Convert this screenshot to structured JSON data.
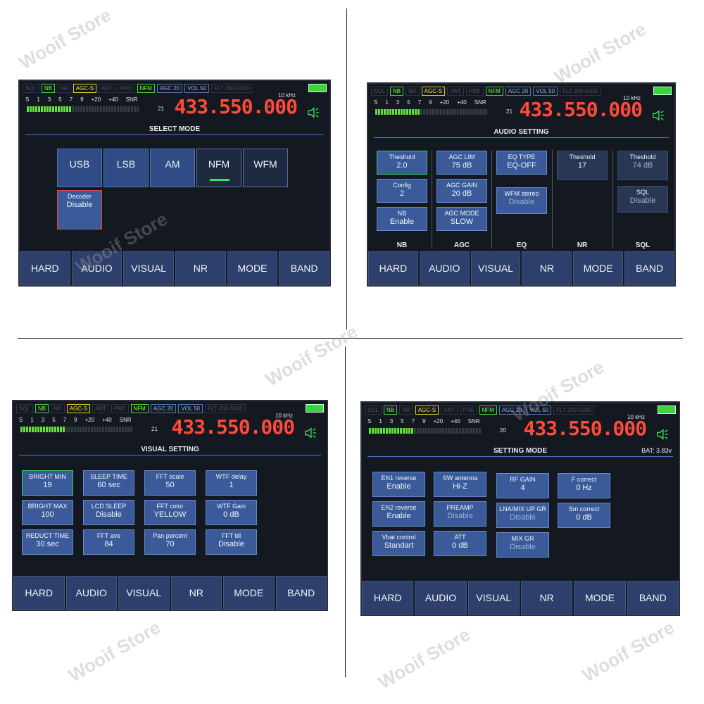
{
  "watermark": "Wooif Store",
  "status": {
    "items": [
      "SQL",
      "NB",
      "NR",
      "AGC-S",
      "ANT",
      "PRE",
      "NFM",
      "AGC 20",
      "VOL 50",
      "FLT 200-5000"
    ]
  },
  "meter": {
    "scale": [
      "S",
      "1",
      "3",
      "5",
      "7",
      "9",
      "+20",
      "+40",
      "SNR"
    ],
    "snr_value": "21",
    "snr_value_alt": "20",
    "step": "10 kHz",
    "frequency": "433.550.000"
  },
  "nav": [
    "HARD",
    "AUDIO",
    "VISUAL",
    "NR",
    "MODE",
    "BAND"
  ],
  "panel1": {
    "title": "SELECT MODE",
    "modes": [
      "USB",
      "LSB",
      "AM",
      "NFM",
      "WFM"
    ],
    "decoder_label": "Decoder",
    "decoder_value": "Disable"
  },
  "panel2": {
    "title": "AUDIO SETTING",
    "buttons": [
      {
        "label": "Theshold",
        "value": "2.0"
      },
      {
        "label": "Config",
        "value": "2"
      },
      {
        "label": "NB",
        "value": "Enable"
      },
      {
        "label": "AGC LIM",
        "value": "75 dB"
      },
      {
        "label": "AGC GAIN",
        "value": "20 dB"
      },
      {
        "label": "AGC MODE",
        "value": "SLOW"
      },
      {
        "label": "EQ TYPE",
        "value": "EQ-OFF"
      },
      {
        "label": "WFM stereo",
        "value": "Disable"
      },
      {
        "label": "Theshold",
        "value": "17"
      },
      {
        "label": "Theshold",
        "value": "74 dB"
      },
      {
        "label": "SQL",
        "value": "Disable"
      }
    ],
    "columns": [
      "NB",
      "AGC",
      "EQ",
      "NR",
      "SQL"
    ]
  },
  "panel3": {
    "title": "VISUAL SETTING",
    "buttons": [
      {
        "label": "BRIGHT MIN",
        "value": "19"
      },
      {
        "label": "BRIGHT MAX",
        "value": "100"
      },
      {
        "label": "REDUCT TIME",
        "value": "30 sec"
      },
      {
        "label": "SLEEP TIME",
        "value": "60 sec"
      },
      {
        "label": "LCD SLEEP",
        "value": "Disable"
      },
      {
        "label": "FFT ave",
        "value": "84"
      },
      {
        "label": "FFT scale",
        "value": "50"
      },
      {
        "label": "FFT color",
        "value": "YELLOW"
      },
      {
        "label": "Pan percent",
        "value": "70"
      },
      {
        "label": "WTF delay",
        "value": "1"
      },
      {
        "label": "WTF Gain",
        "value": "0 dB"
      },
      {
        "label": "FFT till",
        "value": "Disable"
      }
    ]
  },
  "panel4": {
    "title": "SETTING MODE",
    "battery": "BAT: 3.83v",
    "buttons": [
      {
        "label": "EN1 reverse",
        "value": "Enable"
      },
      {
        "label": "EN2 reverse",
        "value": "Enable"
      },
      {
        "label": "Vbat control",
        "value": "Standart"
      },
      {
        "label": "SW antenna",
        "value": "Hi-Z"
      },
      {
        "label": "PREAMP",
        "value": "Disable"
      },
      {
        "label": "ATT",
        "value": "0 dB"
      },
      {
        "label": "RF GAIN",
        "value": "4"
      },
      {
        "label": "LNA/MIX UP GR",
        "value": "Disable"
      },
      {
        "label": "MIX GR",
        "value": "Disable"
      },
      {
        "label": "F correct",
        "value": "0 Hz"
      },
      {
        "label": "Sm correct",
        "value": "0 dB"
      }
    ]
  },
  "colors": {
    "freq": "#ff4a3a",
    "accent_green": "#39e05a",
    "button_blue": "#3a5a9a",
    "screen_bg": "#141821"
  }
}
